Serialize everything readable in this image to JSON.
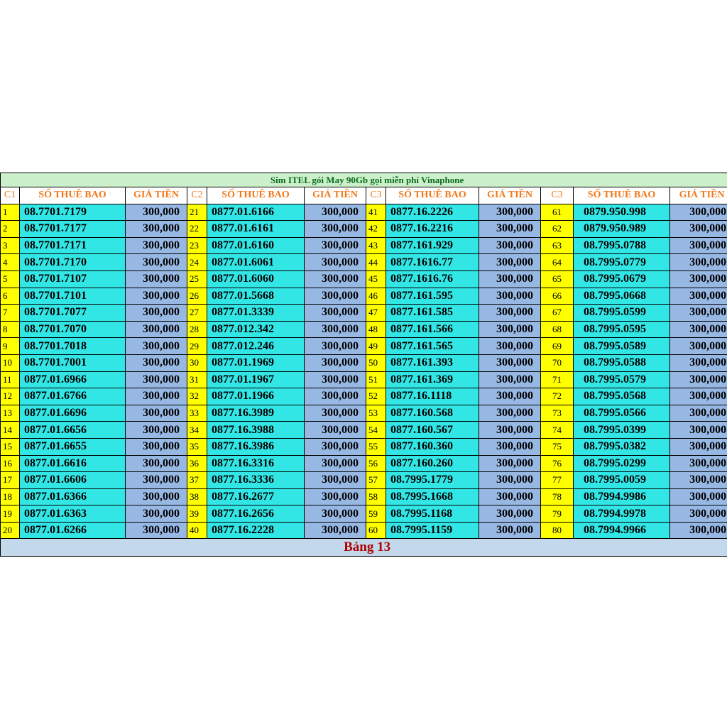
{
  "title": "Sim ITEL gói May 90Gb gọi miễn phí Vinaphone",
  "headers": [
    "C1",
    "SỐ THUÊ BAO",
    "GIÁ TIỀN",
    "C2",
    "SỐ THUÊ BAO",
    "GIÁ TIỀN",
    "C3",
    "SỐ THUÊ BAO",
    "GIÁ TIỀN",
    "C3",
    "SỐ THUÊ BAO",
    "GIÁ TIỀN"
  ],
  "rows": [
    [
      "1",
      "08.7701.7179",
      "300,000",
      "21",
      "0877.01.6166",
      "300,000",
      "41",
      "0877.16.2226",
      "300,000",
      "61",
      "0879.950.998",
      "300,000"
    ],
    [
      "2",
      "08.7701.7177",
      "300,000",
      "22",
      "0877.01.6161",
      "300,000",
      "42",
      "0877.16.2216",
      "300,000",
      "62",
      "0879.950.989",
      "300,000"
    ],
    [
      "3",
      "08.7701.7171",
      "300,000",
      "23",
      "0877.01.6160",
      "300,000",
      "43",
      "0877.161.929",
      "300,000",
      "63",
      "08.7995.0788",
      "300,000"
    ],
    [
      "4",
      "08.7701.7170",
      "300,000",
      "24",
      "0877.01.6061",
      "300,000",
      "44",
      "0877.1616.77",
      "300,000",
      "64",
      "08.7995.0779",
      "300,000"
    ],
    [
      "5",
      "08.7701.7107",
      "300,000",
      "25",
      "0877.01.6060",
      "300,000",
      "45",
      "0877.1616.76",
      "300,000",
      "65",
      "08.7995.0679",
      "300,000"
    ],
    [
      "6",
      "08.7701.7101",
      "300,000",
      "26",
      "0877.01.5668",
      "300,000",
      "46",
      "0877.161.595",
      "300,000",
      "66",
      "08.7995.0668",
      "300,000"
    ],
    [
      "7",
      "08.7701.7077",
      "300,000",
      "27",
      "0877.01.3339",
      "300,000",
      "47",
      "0877.161.585",
      "300,000",
      "67",
      "08.7995.0599",
      "300,000"
    ],
    [
      "8",
      "08.7701.7070",
      "300,000",
      "28",
      "0877.012.342",
      "300,000",
      "48",
      "0877.161.566",
      "300,000",
      "68",
      "08.7995.0595",
      "300,000"
    ],
    [
      "9",
      "08.7701.7018",
      "300,000",
      "29",
      "0877.012.246",
      "300,000",
      "49",
      "0877.161.565",
      "300,000",
      "69",
      "08.7995.0589",
      "300,000"
    ],
    [
      "10",
      "08.7701.7001",
      "300,000",
      "30",
      "0877.01.1969",
      "300,000",
      "50",
      "0877.161.393",
      "300,000",
      "70",
      "08.7995.0588",
      "300,000"
    ],
    [
      "11",
      "0877.01.6966",
      "300,000",
      "31",
      "0877.01.1967",
      "300,000",
      "51",
      "0877.161.369",
      "300,000",
      "71",
      "08.7995.0579",
      "300,000"
    ],
    [
      "12",
      "0877.01.6766",
      "300,000",
      "32",
      "0877.01.1966",
      "300,000",
      "52",
      "0877.16.1118",
      "300,000",
      "72",
      "08.7995.0568",
      "300,000"
    ],
    [
      "13",
      "0877.01.6696",
      "300,000",
      "33",
      "0877.16.3989",
      "300,000",
      "53",
      "0877.160.568",
      "300,000",
      "73",
      "08.7995.0566",
      "300,000"
    ],
    [
      "14",
      "0877.01.6656",
      "300,000",
      "34",
      "0877.16.3988",
      "300,000",
      "54",
      "0877.160.567",
      "300,000",
      "74",
      "08.7995.0399",
      "300,000"
    ],
    [
      "15",
      "0877.01.6655",
      "300,000",
      "35",
      "0877.16.3986",
      "300,000",
      "55",
      "0877.160.360",
      "300,000",
      "75",
      "08.7995.0382",
      "300,000"
    ],
    [
      "16",
      "0877.01.6616",
      "300,000",
      "36",
      "0877.16.3316",
      "300,000",
      "56",
      "0877.160.260",
      "300,000",
      "76",
      "08.7995.0299",
      "300,000"
    ],
    [
      "17",
      "0877.01.6606",
      "300,000",
      "37",
      "0877.16.3336",
      "300,000",
      "57",
      "08.7995.1779",
      "300,000",
      "77",
      "08.7995.0059",
      "300,000"
    ],
    [
      "18",
      "0877.01.6366",
      "300,000",
      "38",
      "0877.16.2677",
      "300,000",
      "58",
      "08.7995.1668",
      "300,000",
      "78",
      "08.7994.9986",
      "300,000"
    ],
    [
      "19",
      "0877.01.6363",
      "300,000",
      "39",
      "0877.16.2656",
      "300,000",
      "59",
      "08.7995.1168",
      "300,000",
      "79",
      "08.7994.9978",
      "300,000"
    ],
    [
      "20",
      "0877.01.6266",
      "300,000",
      "40",
      "0877.16.2228",
      "300,000",
      "60",
      "08.7995.1159",
      "300,000",
      "80",
      "08.7994.9966",
      "300,000"
    ]
  ],
  "footer": "Bảng 13",
  "colors": {
    "title_bg": "#ccf0cc",
    "title_text": "#0b6b1a",
    "header_text": "#f07818",
    "index_bg": "#ffff00",
    "number_bg": "#33e6e6",
    "price_bg": "#98b8e4",
    "footer_bg": "#c4d8ec",
    "footer_text": "#b00000"
  }
}
